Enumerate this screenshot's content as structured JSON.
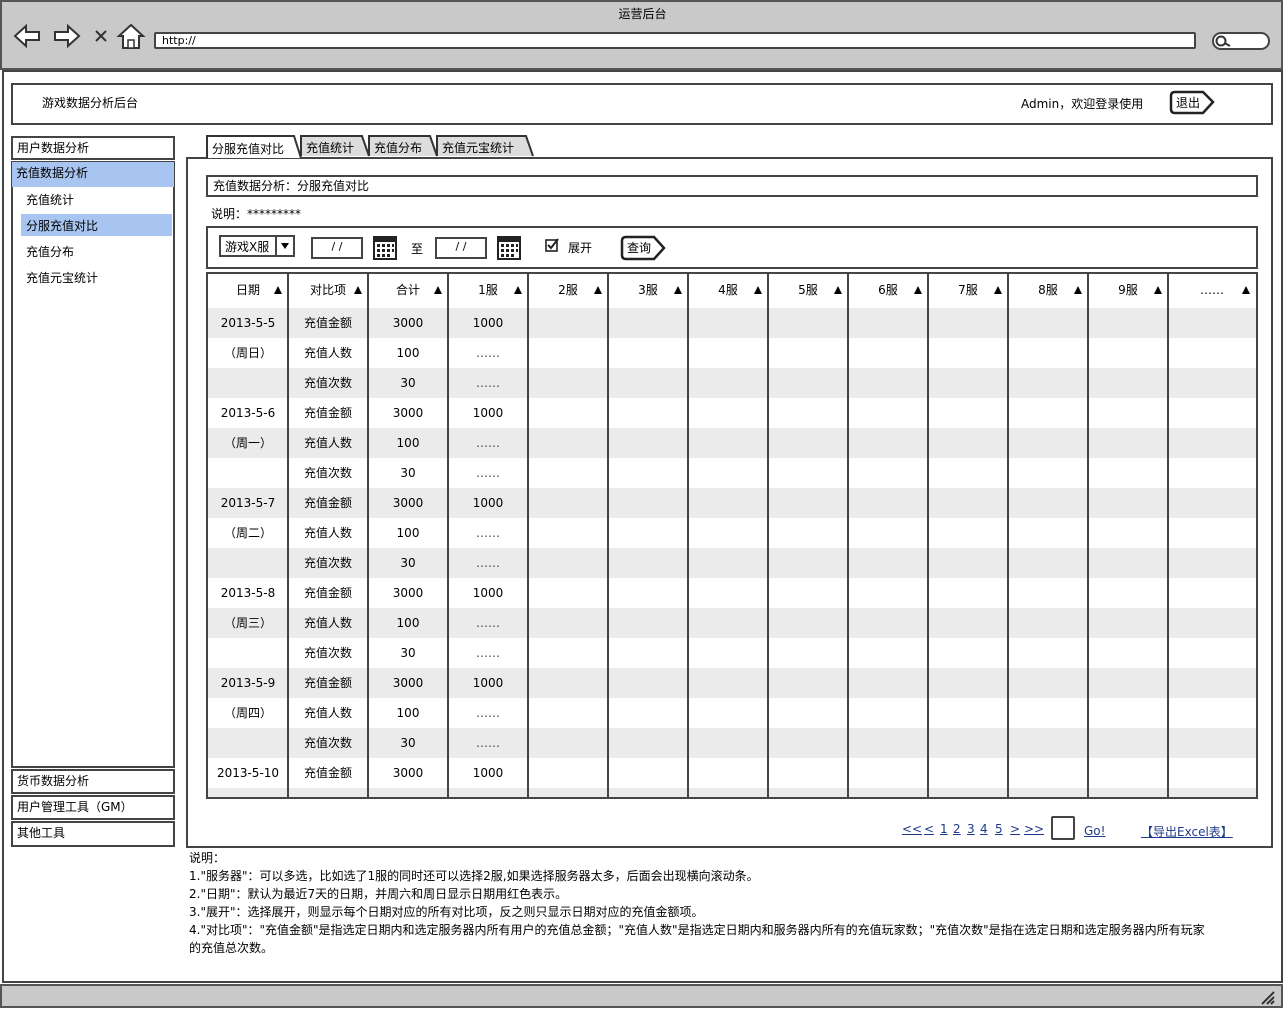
{
  "window": {
    "title": "运营后台",
    "url": "http://"
  },
  "header": {
    "app_title": "游戏数据分析后台",
    "welcome": "Admin，欢迎登录使用",
    "logout": "退出"
  },
  "sidebar": {
    "top_items": [
      "用户数据分析",
      "充值数据分析"
    ],
    "sub_items": [
      "充值统计",
      "分服充值对比",
      "充值分布",
      "充值元宝统计"
    ],
    "bottom_items": [
      "货币数据分析",
      "用户管理工具（GM）",
      "其他工具"
    ],
    "selected": "分服充值对比"
  },
  "tabs": [
    "分服充值对比",
    "充值统计",
    "充值分布",
    "充值元宝统计"
  ],
  "content": {
    "title": "充值数据分析：分服充值对比",
    "note": "说明：*********",
    "server_select": "游戏X服",
    "date_from": "/ /",
    "date_to": "/ /",
    "to": "至",
    "expand": "展开",
    "expand_checked": true,
    "query": "查询"
  },
  "table": {
    "headers": [
      "日期",
      "对比项",
      "合计",
      "1服",
      "2服",
      "3服",
      "4服",
      "5服",
      "6服",
      "7服",
      "8服",
      "9服",
      "……"
    ],
    "rows": [
      {
        "date": "2013-5-5",
        "item": "充值金额",
        "total": "3000",
        "s1": "1000"
      },
      {
        "date": "（周日）",
        "item": "充值人数",
        "total": "100",
        "s1": "……"
      },
      {
        "date": "",
        "item": "充值次数",
        "total": "30",
        "s1": "……"
      },
      {
        "date": "2013-5-6",
        "item": "充值金额",
        "total": "3000",
        "s1": "1000"
      },
      {
        "date": "（周一）",
        "item": "充值人数",
        "total": "100",
        "s1": "……"
      },
      {
        "date": "",
        "item": "充值次数",
        "total": "30",
        "s1": "……"
      },
      {
        "date": "2013-5-7",
        "item": "充值金额",
        "total": "3000",
        "s1": "1000"
      },
      {
        "date": "（周二）",
        "item": "充值人数",
        "total": "100",
        "s1": "……"
      },
      {
        "date": "",
        "item": "充值次数",
        "total": "30",
        "s1": "……"
      },
      {
        "date": "2013-5-8",
        "item": "充值金额",
        "total": "3000",
        "s1": "1000"
      },
      {
        "date": "（周三）",
        "item": "充值人数",
        "total": "100",
        "s1": "……"
      },
      {
        "date": "",
        "item": "充值次数",
        "total": "30",
        "s1": "……"
      },
      {
        "date": "2013-5-9",
        "item": "充值金额",
        "total": "3000",
        "s1": "1000"
      },
      {
        "date": "（周四）",
        "item": "充值人数",
        "total": "100",
        "s1": "……"
      },
      {
        "date": "",
        "item": "充值次数",
        "total": "30",
        "s1": "……"
      },
      {
        "date": "2013-5-10",
        "item": "充值金额",
        "total": "3000",
        "s1": "1000"
      }
    ]
  },
  "pagination": {
    "first": "<<",
    "prev": "<",
    "pages": [
      "1",
      "2",
      "3",
      "4",
      "5"
    ],
    "next": ">",
    "last": ">>",
    "go": "Go!",
    "export": "【导出Excel表】"
  },
  "description": {
    "heading": "说明：",
    "lines": [
      "1.\"服务器\"：可以多选，比如选了1服的同时还可以选择2服,如果选择服务器太多，后面会出现横向滚动条。",
      "2.\"日期\"：默认为最近7天的日期，并周六和周日显示日期用红色表示。",
      "3.\"展开\"：选择展开，则显示每个日期对应的所有对比项，反之则只显示日期对应的充值金额项。",
      "4.\"对比项\"：\"充值金额\"是指选定日期内和选定服务器内所有用户的充值总金额；\"充值人数\"是指选定日期内和服务器内所有的充值玩家数；\"充值次数\"是指在选定日期和选定服务器内所有玩家",
      "的充值总次数。"
    ]
  }
}
